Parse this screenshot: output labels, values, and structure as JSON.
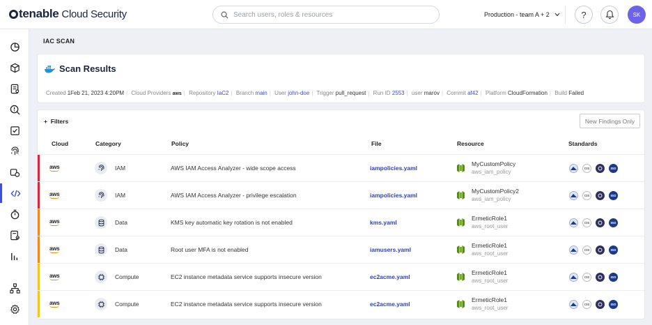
{
  "app": {
    "brand": "tenable",
    "brand_sub": "Cloud Security"
  },
  "search": {
    "placeholder": "Search users, roles & resources"
  },
  "env": {
    "label": "Production - team A + 2"
  },
  "help": {
    "label": "?"
  },
  "user": {
    "initials": "SK",
    "avatar_color": "#6c63e8"
  },
  "sidebar": {
    "icons": [
      "dashboard-icon",
      "cube-icon",
      "inventory-icon",
      "findings-icon",
      "compliance-icon",
      "fingerprint-icon",
      "access-icon",
      "code-icon",
      "timer-icon",
      "reports-icon",
      "analytics-icon",
      "hierarchy-icon",
      "settings-icon"
    ],
    "active": "code-icon"
  },
  "breadcrumb": "IAC SCAN",
  "scan": {
    "title": "Scan Results",
    "meta": {
      "created_label": "Created",
      "created_value": "1Feb 21, 2023 4:20PM",
      "providers_label": "Cloud Providers",
      "providers_value": "aws",
      "repo_label": "Repository",
      "repo_value": "IaC2",
      "branch_label": "Branch",
      "branch_value": "main",
      "user_label": "User",
      "user_value": "john-doe",
      "trigger_label": "Trigger",
      "trigger_value": "pull_request",
      "runid_label": "Run ID",
      "runid_value": "2553",
      "user2_label": "user",
      "user2_value": "marov",
      "commit_label": "Commit",
      "commit_value": "af42",
      "platform_label": "Platform",
      "platform_value": "CloudFormation",
      "build_label": "Build",
      "build_value": "Failed"
    }
  },
  "findings": {
    "filters_label": "Filters",
    "new_findings_button": "New Findings Only",
    "columns": [
      "Cloud",
      "Category",
      "Policy",
      "File",
      "Resource",
      "Standards"
    ],
    "rows": [
      {
        "cloud": "aws",
        "category": "IAM",
        "policy": "AWS IAM Access Analyzer - wide scope access",
        "file": "iampolicies.yaml",
        "resource_name": "MyCustomPolicy",
        "resource_type": "aws_iam_policy",
        "severity_color": "#d8263b",
        "cat_icon": "fingerprint-icon"
      },
      {
        "cloud": "aws",
        "category": "IAM",
        "policy": "AWS IAM Access Analyzer - privilege escalation",
        "file": "iampolicies.yaml",
        "resource_name": "MyCustomPolicy2",
        "resource_type": "aws_iam_policy",
        "severity_color": "#d8263b",
        "cat_icon": "fingerprint-icon"
      },
      {
        "cloud": "aws",
        "category": "Data",
        "policy": "KMS key automatic key rotation is not enabled",
        "file": "kms.yaml",
        "resource_name": "ErmeticRole1",
        "resource_type": "aws_root_user",
        "severity_color": "#ef8a1a",
        "cat_icon": "database-icon"
      },
      {
        "cloud": "aws",
        "category": "Data",
        "policy": "Root user MFA is not enabled",
        "file": "iamusers.yaml",
        "resource_name": "ErmeticRole1",
        "resource_type": "aws_root_user",
        "severity_color": "#ef8a1a",
        "cat_icon": "database-icon"
      },
      {
        "cloud": "aws",
        "category": "Compute",
        "policy": "EC2 instance metadata service supports insecure version",
        "file": "ec2acme.yaml",
        "resource_name": "ErmeticRole1",
        "resource_type": "aws_root_user",
        "severity_color": "#f4c51a",
        "cat_icon": "chip-icon"
      },
      {
        "cloud": "aws",
        "category": "Compute",
        "policy": "EC2 instance metadata service supports insecure version",
        "file": "ec2acme.yaml",
        "resource_name": "ErmeticRole1",
        "resource_type": "aws_root_user",
        "severity_color": "#f4c51a",
        "cat_icon": "chip-icon"
      }
    ],
    "standards_badges": [
      "CIS",
      "ISO"
    ]
  }
}
